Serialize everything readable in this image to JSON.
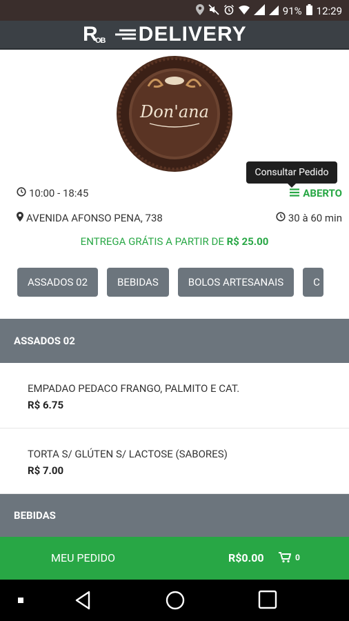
{
  "statusbar": {
    "battery": "91%",
    "time": "12:29"
  },
  "app": {
    "brand_rob": "R",
    "brand_ob": "OB",
    "brand_delivery": "DELIVERY"
  },
  "store": {
    "logo_text": "Don'ana",
    "tooltip": "Consultar Pedido",
    "hours": "10:00 - 18:45",
    "status": "ABERTO",
    "address": "AVENIDA AFONSO PENA, 738",
    "delivery_time": "30 à 60 min",
    "free_shipping_prefix": "ENTREGA GRÁTIS A PARTIR DE",
    "free_shipping_value": "R$ 25.00"
  },
  "categories": [
    "ASSADOS 02",
    "BEBIDAS",
    "BOLOS ARTESANAIS",
    "C"
  ],
  "sections": [
    {
      "title": "ASSADOS 02",
      "items": [
        {
          "name": "EMPADAO PEDACO FRANGO, PALMITO E CAT.",
          "price": "R$ 6.75"
        },
        {
          "name": "TORTA S/ GLÚTEN S/ LACTOSE (SABORES)",
          "price": "R$ 7.00"
        }
      ]
    },
    {
      "title": "BEBIDAS",
      "items": []
    }
  ],
  "order": {
    "label": "MEU PEDIDO",
    "total": "R$0.00",
    "cart_count": "0"
  },
  "colors": {
    "accent_green": "#28a745",
    "category_gray": "#6c757d",
    "appbar": "#3b4045"
  }
}
